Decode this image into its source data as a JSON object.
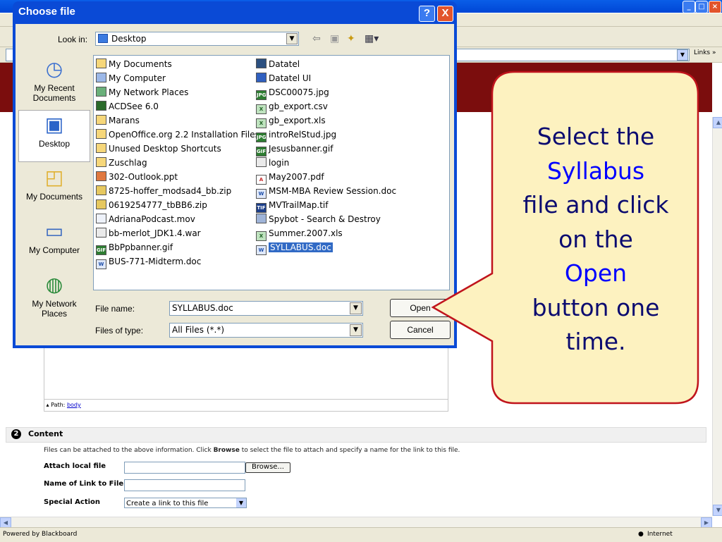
{
  "browser": {
    "links_label": "Links",
    "status_left": "Powered by Blackboard",
    "status_zone": "Internet"
  },
  "page": {
    "path_label": "Path:",
    "path_link": "body",
    "section_number": "2",
    "section_title": "Content",
    "desc_part1": "Files can be attached to the above information. Click ",
    "desc_bold": "Browse",
    "desc_part2": " to select the file to attach and specify a name for the link to this file.",
    "attach_label": "Attach local file",
    "browse_label": "Browse...",
    "link_name_label": "Name of Link to File",
    "special_action_label": "Special Action",
    "special_action_value": "Create a link to this file"
  },
  "dialog": {
    "title": "Choose file",
    "help_glyph": "?",
    "close_glyph": "X",
    "look_in_label": "Look in:",
    "look_in_value": "Desktop",
    "places": [
      {
        "label": "My Recent Documents",
        "icon": "recent-documents-icon"
      },
      {
        "label": "Desktop",
        "icon": "desktop-icon"
      },
      {
        "label": "My Documents",
        "icon": "my-documents-icon"
      },
      {
        "label": "My Computer",
        "icon": "my-computer-icon"
      },
      {
        "label": "My Network Places",
        "icon": "network-places-icon"
      }
    ],
    "files_col1": [
      {
        "name": "My Documents",
        "icon": "folder-docs"
      },
      {
        "name": "My Computer",
        "icon": "computer"
      },
      {
        "name": "My Network Places",
        "icon": "network"
      },
      {
        "name": "ACDSee 6.0",
        "icon": "app"
      },
      {
        "name": "Marans",
        "icon": "folder"
      },
      {
        "name": "OpenOffice.org 2.2 Installation Files",
        "icon": "folder"
      },
      {
        "name": "Unused Desktop Shortcuts",
        "icon": "folder"
      },
      {
        "name": "Zuschlag",
        "icon": "folder"
      },
      {
        "name": "302-Outlook.ppt",
        "icon": "ppt"
      },
      {
        "name": "8725-hoffer_modsad4_bb.zip",
        "icon": "zip"
      },
      {
        "name": "0619254777_tbBB6.zip",
        "icon": "zip"
      },
      {
        "name": "AdrianaPodcast.mov",
        "icon": "mov"
      },
      {
        "name": "bb-merlot_JDK1.4.war",
        "icon": "war"
      },
      {
        "name": "BbPpbanner.gif",
        "icon": "gif"
      },
      {
        "name": "BUS-771-Midterm.doc",
        "icon": "doc"
      }
    ],
    "files_col2": [
      {
        "name": "Datatel",
        "icon": "app"
      },
      {
        "name": "Datatel UI",
        "icon": "app"
      },
      {
        "name": "DSC00075.jpg",
        "icon": "jpg"
      },
      {
        "name": "gb_export.csv",
        "icon": "xls"
      },
      {
        "name": "gb_export.xls",
        "icon": "xls"
      },
      {
        "name": "introRelStud.jpg",
        "icon": "jpg"
      },
      {
        "name": "Jesusbanner.gif",
        "icon": "gif"
      },
      {
        "name": "login",
        "icon": "file"
      },
      {
        "name": "May2007.pdf",
        "icon": "pdf"
      },
      {
        "name": "MSM-MBA Review Session.doc",
        "icon": "doc"
      },
      {
        "name": "MVTrailMap.tif",
        "icon": "tif"
      },
      {
        "name": "Spybot - Search & Destroy",
        "icon": "app"
      },
      {
        "name": "Summer.2007.xls",
        "icon": "xls"
      },
      {
        "name": "SYLLABUS.doc",
        "icon": "doc",
        "selected": true
      }
    ],
    "file_name_label": "File name:",
    "file_name_value": "SYLLABUS.doc",
    "file_type_label": "Files of type:",
    "file_type_value": "All Files (*.*)",
    "open_label": "Open",
    "cancel_label": "Cancel"
  },
  "callout": {
    "line1": "Select the",
    "line2": "Syllabus",
    "line3": "file and click",
    "line4": "on the",
    "line5": "Open",
    "line6": "button one",
    "line7": "time."
  },
  "colors": {
    "title_blue": "#0a4ad6",
    "selection": "#316ac5",
    "callout_fill": "#fdf2c0",
    "callout_border": "#c0141c",
    "callout_text": "#0b0b70",
    "callout_highlight": "#0000ff"
  }
}
